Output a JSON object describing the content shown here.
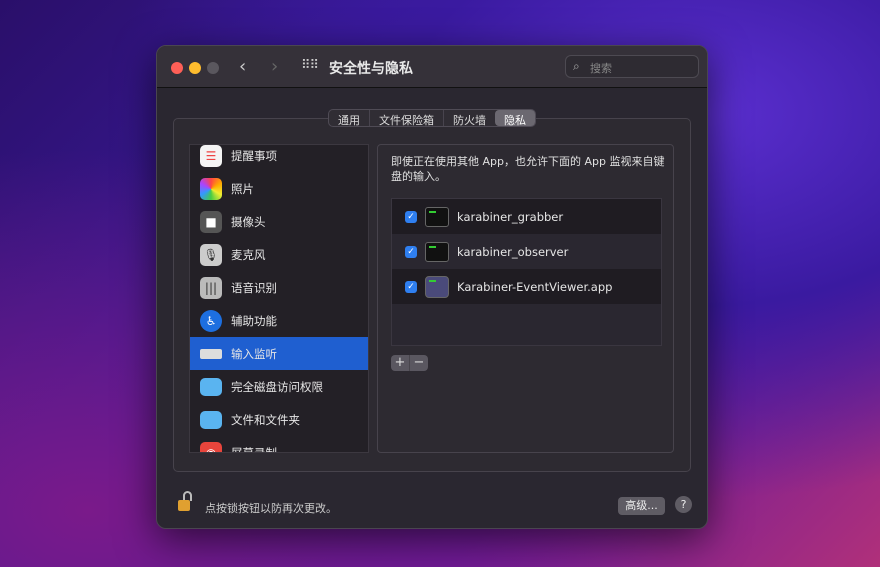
{
  "window": {
    "title": "安全性与隐私",
    "search_placeholder": "搜索"
  },
  "tabs": [
    {
      "label": "通用"
    },
    {
      "label": "文件保险箱"
    },
    {
      "label": "防火墙"
    },
    {
      "label": "隐私",
      "selected": true
    }
  ],
  "sidebar": {
    "items": [
      {
        "label": "提醒事项",
        "icon": "reminders-icon"
      },
      {
        "label": "照片",
        "icon": "photos-icon"
      },
      {
        "label": "摄像头",
        "icon": "camera-icon"
      },
      {
        "label": "麦克风",
        "icon": "microphone-icon"
      },
      {
        "label": "语音识别",
        "icon": "speech-recognition-icon"
      },
      {
        "label": "辅助功能",
        "icon": "accessibility-icon"
      },
      {
        "label": "输入监听",
        "icon": "keyboard-icon",
        "selected": true
      },
      {
        "label": "完全磁盘访问权限",
        "icon": "folder-icon"
      },
      {
        "label": "文件和文件夹",
        "icon": "folder-icon"
      },
      {
        "label": "屏幕录制",
        "icon": "screen-recording-icon"
      }
    ]
  },
  "main": {
    "description": "即使正在使用其他 App，也允许下面的 App 监视来自键盘的输入。",
    "apps": [
      {
        "name": "karabiner_grabber",
        "checked": true
      },
      {
        "name": "karabiner_observer",
        "checked": true
      },
      {
        "name": "Karabiner-EventViewer.app",
        "checked": true
      }
    ],
    "add_label": "+",
    "remove_label": "−"
  },
  "footer": {
    "lock_text": "点按锁按钮以防再次更改。",
    "advanced_label": "高级...",
    "help_label": "?"
  }
}
